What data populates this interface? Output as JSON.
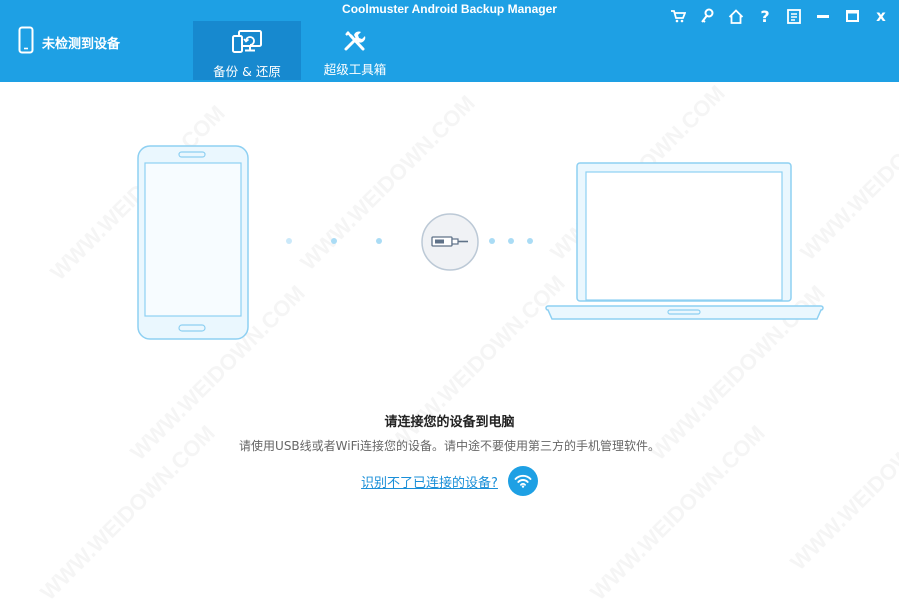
{
  "app": {
    "title": "Coolmuster Android Backup Manager"
  },
  "device": {
    "status": "未检测到设备"
  },
  "tabs": [
    {
      "label": "备份 & 还原",
      "icon": "backup-restore-icon",
      "active": true
    },
    {
      "label": "超级工具箱",
      "icon": "toolbox-icon",
      "active": false
    }
  ],
  "window_buttons": [
    "cart-icon",
    "key-icon",
    "home-icon",
    "help-icon",
    "feedback-icon",
    "minimize-icon",
    "maximize-icon",
    "close-icon"
  ],
  "window_glyphs": {
    "help": "?",
    "close": "x"
  },
  "prompt": {
    "title": "请连接您的设备到电脑",
    "subtitle": "请使用USB线或者WiFi连接您的设备。请中途不要使用第三方的手机管理软件。",
    "help_link": "识别不了已连接的设备?"
  },
  "watermark": "WWW.WEIDOWN.COM",
  "colors": {
    "header": "#1ea0e4",
    "active_tab": "#1789cf",
    "accent_link": "#1a8fd8",
    "illustration": "#8ed0f2"
  }
}
